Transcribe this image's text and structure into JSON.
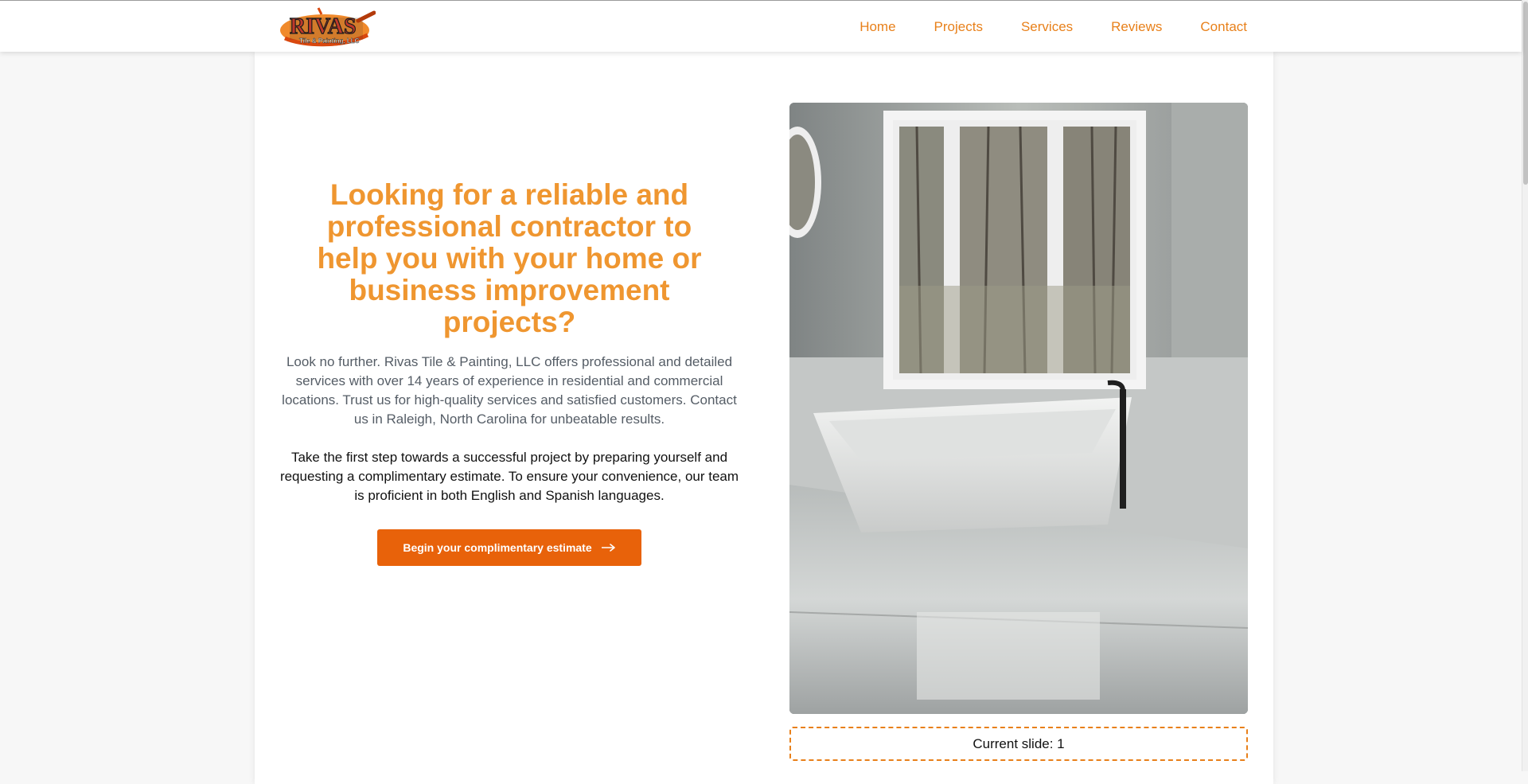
{
  "header": {
    "logo_text": "RIVAS",
    "logo_subtext": "Tile & Painting, LLC",
    "nav": [
      {
        "label": "Home"
      },
      {
        "label": "Projects"
      },
      {
        "label": "Services"
      },
      {
        "label": "Reviews"
      },
      {
        "label": "Contact"
      }
    ]
  },
  "hero": {
    "headline": "Looking for a reliable and professional contractor to help you with your home or business improvement projects?",
    "lead": "Look no further. Rivas Tile & Painting, LLC offers professional and detailed services with over 14 years of experience in residential and commercial locations. Trust us for high-quality services and satisfied customers. Contact us in Raleigh, North Carolina for unbeatable results.",
    "cta_text": "Take the first step towards a successful project by preparing yourself and requesting a complimentary estimate. To ensure your convenience, our team is proficient in both English and Spanish languages.",
    "cta_button": "Begin your complimentary estimate",
    "cta_icon": "arrow-right-icon"
  },
  "slider": {
    "status": "Current slide: 1",
    "image_alt": "Bathroom with freestanding white tub under large window"
  },
  "colors": {
    "accent": "#e8801a",
    "headline": "#ef9630",
    "button": "#e8620a"
  }
}
